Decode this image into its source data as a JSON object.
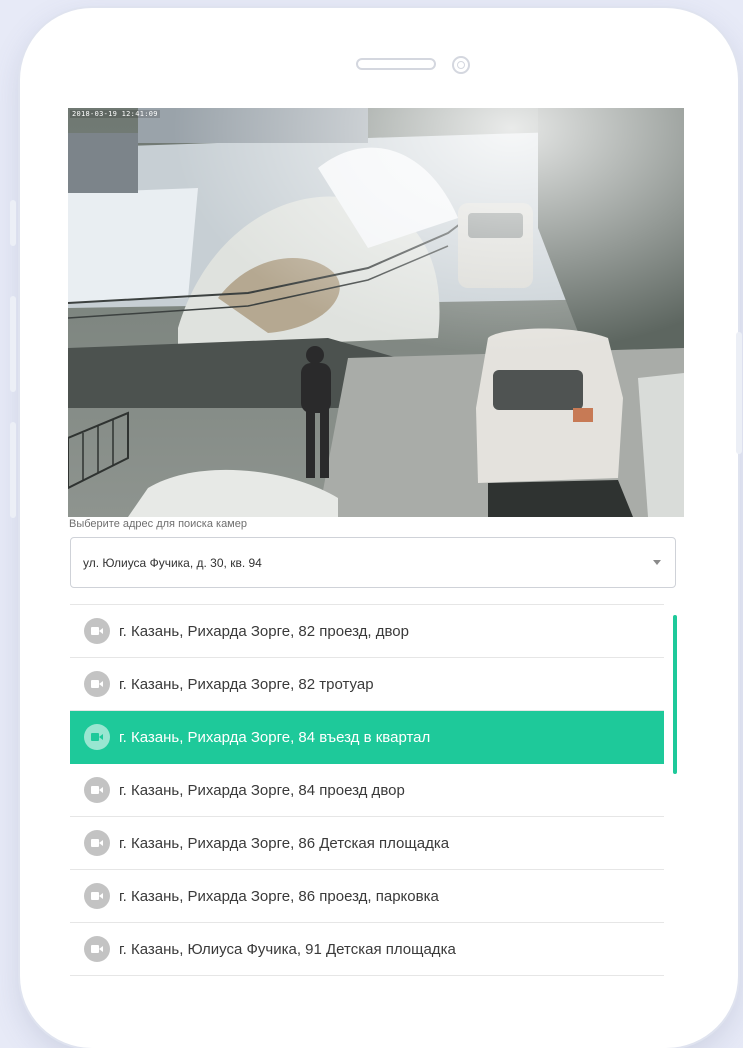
{
  "camera_view": {
    "timestamp": "2018-03-19 12:41:09"
  },
  "address": {
    "label": "Выберите адрес для поиска камер",
    "selected": "ул. Юлиуса Фучика, д. 30, кв. 94"
  },
  "cameras": {
    "items": [
      {
        "label": "г. Казань, Рихарда Зорге, 82 проезд, двор",
        "active": false
      },
      {
        "label": "г. Казань, Рихарда Зорге, 82 тротуар",
        "active": false
      },
      {
        "label": "г. Казань, Рихарда Зорге, 84 въезд в квартал",
        "active": true
      },
      {
        "label": "г. Казань, Рихарда Зорге, 84 проезд двор",
        "active": false
      },
      {
        "label": "г. Казань, Рихарда Зорге, 86 Детская площадка",
        "active": false
      },
      {
        "label": "г. Казань, Рихарда Зорге, 86 проезд, парковка",
        "active": false
      },
      {
        "label": "г. Казань, Юлиуса Фучика, 91 Детская площадка",
        "active": false
      }
    ]
  },
  "colors": {
    "accent": "#1ec99a",
    "background": "#e7eaf7"
  }
}
